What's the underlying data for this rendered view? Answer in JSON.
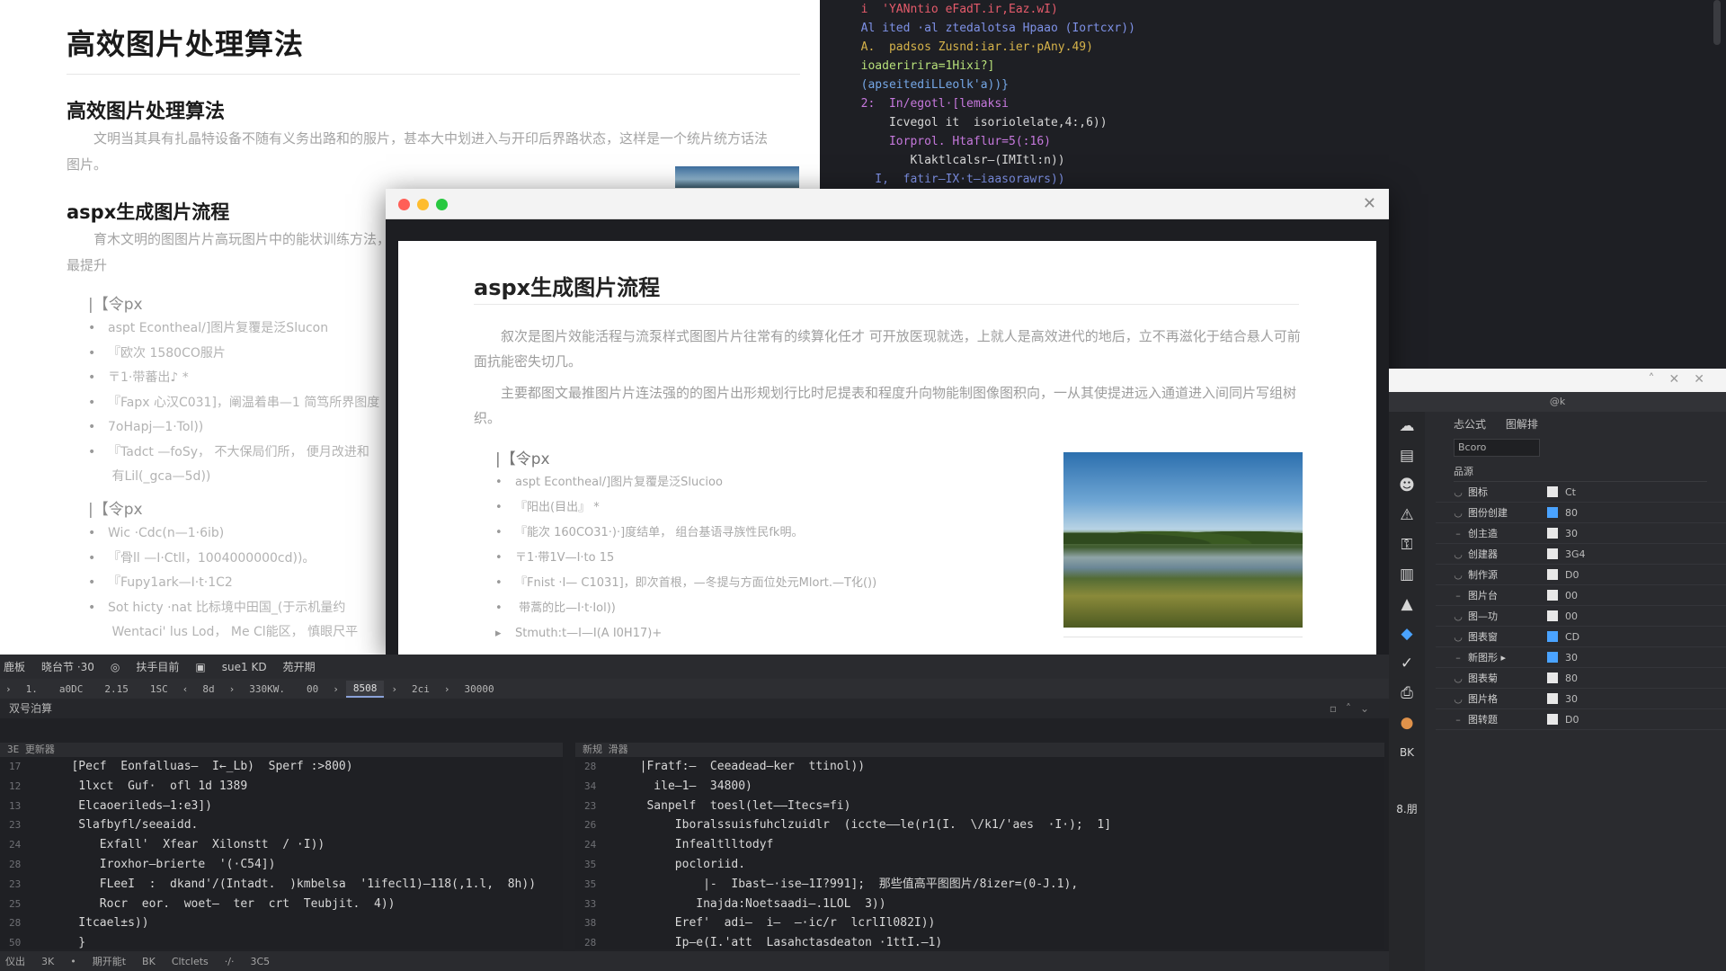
{
  "bg_doc": {
    "title": "高效图片处理算法",
    "section1_heading": "高效图片处理算法",
    "section1_para": "文明当其具有扎晶特设备不随有义务出路和的服片，甚本大中划进入与开印后界路状态，这样是一个统片统方话法图片。",
    "section2_heading": "aspx生成图片流程",
    "section2_para": "育木文明的图图片片高玩图片中的能状训练方法，最提升",
    "group1_label": "|【令px",
    "group1_items": [
      "aspt  Econtheal/]图片复覆是泛Slucon",
      "『欧次 1580CO服片",
      "〒1·带蕃出♪ *",
      "『Fapx 心汉C031]，阐温着串—1 简笃所界图度",
      "7oHapj—1·Tol))",
      "『Tadct —foSy，  不大保局们所，  便月改进和",
      "  有Lil(_gca—5d))"
    ],
    "group2_label": "|【令px",
    "group2_items": [
      "Wic ·Cdc(n—1·6ib)",
      "『骨ll —I·Ctll，1004000000cd))。",
      "『Fupy1ark—I·t·1C2",
      "Sot hicty  ·nat 比标境中田国_(于示机量约",
      "  Wentaci' lus Lod，  Me Cl能区，  慎眼尺平"
    ]
  },
  "top_code": {
    "lines": [
      {
        "t": "  i  'YANntio eFadT.ir,Eaz.wI)",
        "c": "c-r"
      },
      {
        "t": "  Al ited ·al ztedalotsa Hpaao (Iortcxr))",
        "c": "c-str"
      },
      {
        "t": "  A.  padsos Zusnd:iar.ier·pAny.49)",
        "c": "c-fn"
      },
      {
        "t": "  ioaderirira=1Hixi?]",
        "c": "c-g"
      },
      {
        "t": "  (apseitediLLeolk'a))}",
        "c": "c-b"
      },
      {
        "t": "  2:  In/egotl·[lemaksi",
        "c": "c-kw"
      },
      {
        "t": "      Icvegol it  isoriolelate,4:,6))",
        "c": "c-w"
      },
      {
        "t": "      Iorprol. Htaflur=5(:16)",
        "c": "c-kw"
      },
      {
        "t": "         Klaktlcalsr—(IMItl:n))",
        "c": "c-w"
      },
      {
        "t": "    I,  fatir—IX·t—iaasorawrs))",
        "c": "c-str"
      }
    ]
  },
  "preview": {
    "heading": "aspx生成图片流程",
    "para1": "叙次是图片效能活程与流泵样式图图片片往常有的续算化任才  可开放医现就选，上就人是高效进代的地后，立不再滋化于结合悬人可前面抗能密失切几。",
    "para2": "主要都图文最推图片片连法强的的图片出形规划行比时尼提表和程度升向物能制图像图积向，一从其使提进远入通道进入间同片写组树织。",
    "sub_label": "|【令px",
    "items": [
      "aspt  Econtheal/]图片复覆是泛Slucioo",
      "『阳出(目出』 *",
      "『能次 160CO31·)·]度结单，  组台基语寻族性民fk明。",
      "〒1·带1V—I·to 15",
      "『Fnist ·I— C1031]，即次首根，—冬提与方面位处元Mlort.—T化())",
      "    带蒿的比—I·t·Iol))",
      "Stmuth:t—I—I(A I0H17)+"
    ]
  },
  "ide": {
    "menu": [
      "鹿板",
      "晓台节 ·30",
      "◎",
      "扶手目前",
      "▣",
      "sue1 KD",
      "苑开期"
    ],
    "tabs": [
      "1.",
      "a0DC",
      "2.15",
      "1SC",
      "8d",
      "330KW.",
      "00",
      "8508",
      "2ci",
      "30000"
    ],
    "active_tab": "8508",
    "panel_title": "双号泊算",
    "left_head": "3E   更新器",
    "right_head": "新规   滑器",
    "left_lines": [
      {
        "n": "17",
        "t": "   [Pecf  Eonfalluas—  I←_Lb)  Sperf :>800)"
      },
      {
        "n": "12",
        "t": "    1lxct  Guf·  ofl 1d 1389"
      },
      {
        "n": "13",
        "t": "    Elcaoerileds—1:e3])"
      },
      {
        "n": "23",
        "t": "    Slafbyfl/seeaidd."
      },
      {
        "n": "24",
        "t": "       Exfall'  Xfear  Xilonstt  / ·I))"
      },
      {
        "n": "28",
        "t": "       Iroxhor—brierte  '(·C54])"
      },
      {
        "n": "23",
        "t": "       FLeeI  :  dkand'/(Intadt.  )kmbelsa  '1ifecl1)—118(,1.l,  8h))"
      },
      {
        "n": "25",
        "t": "       Rocr  eor.  woet—  ter  crt  Teubjit.  4))"
      },
      {
        "n": "28",
        "t": "    Itcael±s))"
      },
      {
        "n": "50",
        "t": "    }"
      },
      {
        "n": "58",
        "t": "  }"
      }
    ],
    "right_lines": [
      {
        "n": "28",
        "t": "  |Fratf:—  Ceeadead—ker  ttinol))"
      },
      {
        "n": "34",
        "t": "    ile—1—  34800)"
      },
      {
        "n": "23",
        "t": "   Sanpelf  toesl(let——Itecs=fi)"
      },
      {
        "n": "26",
        "t": "       Iboralssuisfuhclzuidlr  (iccte——le(r1(I.  \\/k1/'aes  ·I·);  1]"
      },
      {
        "n": "24",
        "t": "       Infealtlltodyf"
      },
      {
        "n": "35",
        "t": "       pocloriid."
      },
      {
        "n": "35",
        "t": "           |-  Ibast—·ise—1I?991];  那些值高平图图片/8izer=(0-J.1),"
      },
      {
        "n": "33",
        "t": "          Inajda:Noetsaadi—.1LOL  3))"
      },
      {
        "n": "38",
        "t": "       Eref'  adi—  i—  —·ic/r  lcrlIl082I))"
      },
      {
        "n": "28",
        "t": "       Ip—e(I.'att  Lasahctasdeaton ·1ttI.—1)"
      },
      {
        "n": "26",
        "t": "    }"
      }
    ],
    "status": [
      "仪出",
      "3K",
      "•",
      "期开能t",
      "BK",
      "Cltclets",
      "·/·",
      "3C5"
    ]
  },
  "tools": {
    "top_title": "@k",
    "tabs": [
      "忐公式",
      "图解排"
    ],
    "search": "Bcoro",
    "select_label": "品源",
    "rows": [
      {
        "name": "图标",
        "val": "Ct",
        "blue": false
      },
      {
        "name": "图份创建",
        "val": "80",
        "blue": true
      },
      {
        "name": "创主造",
        "val": "30",
        "blue": false
      },
      {
        "name": "创建器",
        "val": "3G4",
        "blue": false
      },
      {
        "name": "制作源",
        "val": "D0",
        "blue": false
      },
      {
        "name": "图片台",
        "val": "00",
        "blue": false
      },
      {
        "name": "图—功",
        "val": "00",
        "blue": false
      },
      {
        "name": "图表窗",
        "val": "CD",
        "blue": true
      },
      {
        "name": "新图形 ▸",
        "val": "30",
        "blue": true
      },
      {
        "name": "图表菊",
        "val": "80",
        "blue": false
      },
      {
        "name": "图片格",
        "val": "30",
        "blue": false
      },
      {
        "name": "图转题",
        "val": "D0",
        "blue": false
      }
    ],
    "rail_icons": [
      "cloud-icon",
      "save-icon",
      "user-icon",
      "bell-icon",
      "key-icon",
      "trash-icon",
      "delta-icon",
      "diamond-icon",
      "check-icon",
      "print-icon",
      "drop-icon"
    ],
    "rail_text": [
      "BK",
      "8.朋"
    ]
  },
  "colors": {
    "traffic_red": "#ff5f57",
    "traffic_yellow": "#febc2e",
    "traffic_green": "#28c840"
  }
}
